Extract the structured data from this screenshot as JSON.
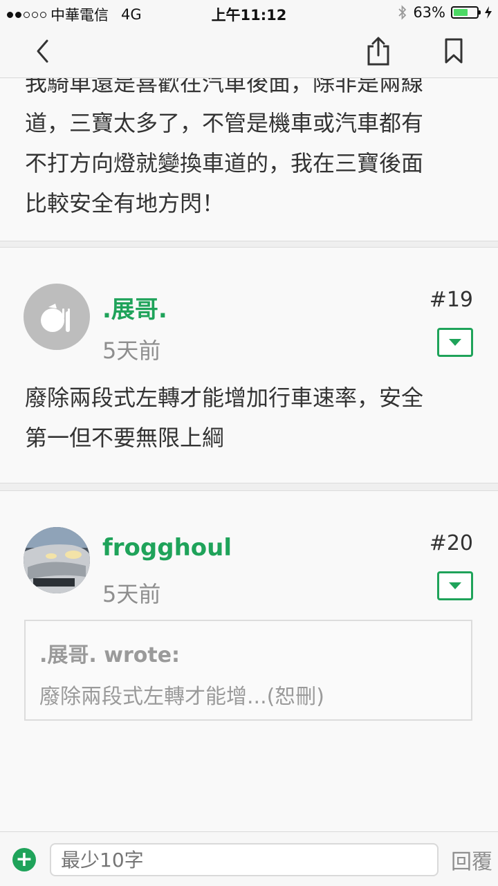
{
  "status_bar": {
    "carrier": "中華電信",
    "network": "4G",
    "time": "上午11:12",
    "battery_percent": "63%",
    "battery_level": 0.63,
    "battery_color": "#4cd964"
  },
  "nav": {
    "back_icon": "chevron-left-icon",
    "share_icon": "share-icon",
    "bookmark_icon": "bookmark-icon"
  },
  "posts": [
    {
      "text_lines": [
        "我騎車還是喜歡在汽車後面，除非是兩線",
        "道，三寶太多了，不管是機車或汽車都有",
        "不打方向燈就變換車道的，我在三寶後面",
        "比較安全有地方閃！"
      ]
    },
    {
      "username": ".展哥.",
      "time_ago": "5天前",
      "floor": "#19",
      "text_lines": [
        "廢除兩段式左轉才能增加行車速率，安全",
        "第一但不要無限上綱"
      ]
    },
    {
      "username": "frogghoul",
      "time_ago": "5天前",
      "floor": "#20",
      "quote": {
        "author": ".展哥. wrote:",
        "text": "廢除兩段式左轉才能增...(恕刪)"
      }
    }
  ],
  "composer": {
    "add_label": "+",
    "placeholder": "最少10字",
    "reply_label": "回覆"
  },
  "colors": {
    "accent": "#1fa35a",
    "muted": "#8e8e8e"
  }
}
